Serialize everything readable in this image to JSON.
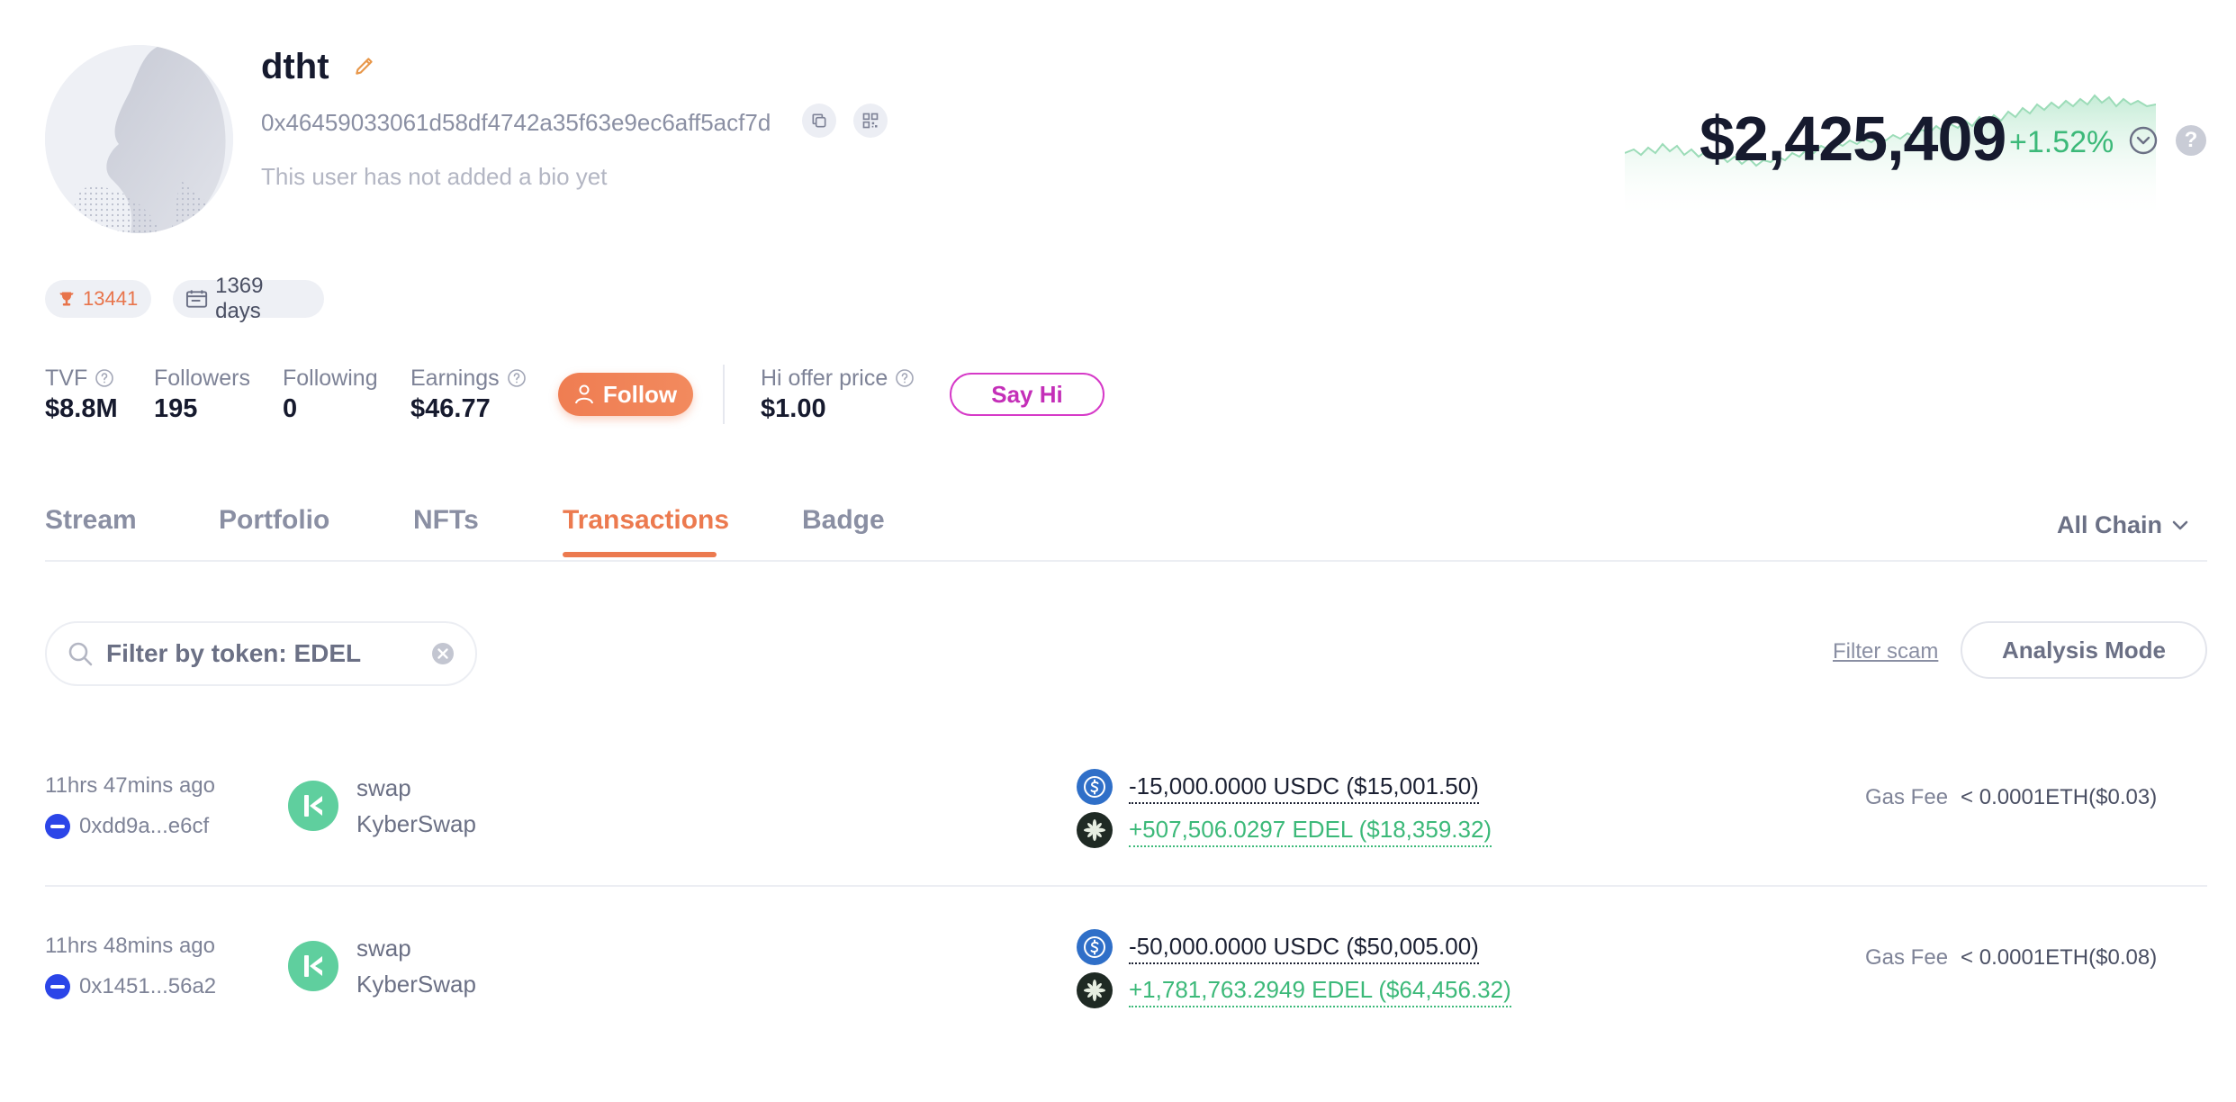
{
  "profile": {
    "username": "dtht",
    "address": "0x46459033061d58df4742a35f63e9ec6aff5acf7d",
    "bio": "This user has not added a bio yet",
    "rank": "13441",
    "days": "1369 days"
  },
  "networth": {
    "value": "$2,425,409",
    "change": "+1.52%",
    "help": "?"
  },
  "stats": {
    "tvf_label": "TVF",
    "tvf_value": "$8.8M",
    "followers_label": "Followers",
    "followers_value": "195",
    "following_label": "Following",
    "following_value": "0",
    "earnings_label": "Earnings",
    "earnings_value": "$46.77",
    "follow_label": "Follow",
    "hi_offer_label": "Hi offer price",
    "hi_offer_value": "$1.00",
    "say_hi_label": "Say Hi"
  },
  "tabs": [
    {
      "label": "Stream"
    },
    {
      "label": "Portfolio"
    },
    {
      "label": "NFTs"
    },
    {
      "label": "Transactions",
      "active": true
    },
    {
      "label": "Badge"
    }
  ],
  "chain_select": "All Chain",
  "filter": {
    "search_value": "Filter by token: EDEL",
    "filter_scam": "Filter scam",
    "analysis_mode": "Analysis Mode"
  },
  "transactions": [
    {
      "time": "11hrs 47mins ago",
      "hash": "0xdd9a...e6cf",
      "type": "swap",
      "protocol": "KyberSwap",
      "out": "-15,000.0000 USDC ($15,001.50)",
      "in": "+507,506.0297 EDEL ($18,359.32)",
      "gas_label": "Gas Fee",
      "gas_value": "< 0.0001ETH($0.03)"
    },
    {
      "time": "11hrs 48mins ago",
      "hash": "0x1451...56a2",
      "type": "swap",
      "protocol": "KyberSwap",
      "out": "-50,000.0000 USDC ($50,005.00)",
      "in": "+1,781,763.2949 EDEL ($64,456.32)",
      "gas_label": "Gas Fee",
      "gas_value": "< 0.0001ETH($0.08)"
    }
  ],
  "colors": {
    "accent": "#ec7a4f",
    "positive": "#3cb979",
    "say_hi": "#c42fb8",
    "eth": "#2b45e8",
    "usdc": "#2f6fc8",
    "kyber": "#5fcf9e"
  }
}
